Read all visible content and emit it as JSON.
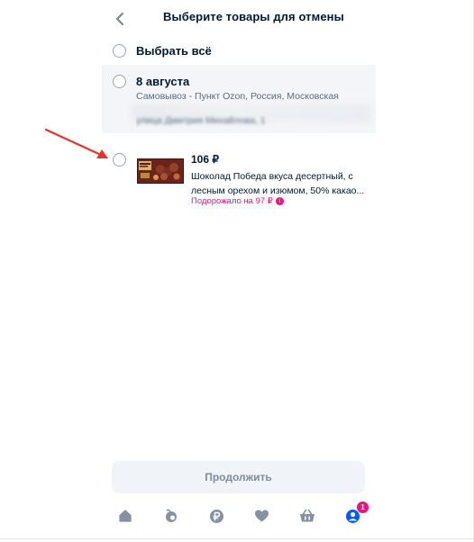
{
  "header": {
    "title": "Выберите товары для отмены"
  },
  "select_all": {
    "label": "Выбрать всё"
  },
  "group": {
    "date": "8 августа",
    "address": "Самовывоз - Пункт Ozon, Россия, Московская",
    "address_blurred": "улица Дмитрия Михайлова, 1"
  },
  "product": {
    "price": "106 ₽",
    "title": "Шоколад Победа вкуса десертный, с лесным орехом и изюмом, 50% какао...",
    "price_note": "Подорожало на 97 ₽",
    "note_icon": "i"
  },
  "footer": {
    "continue_label": "Продолжить"
  },
  "tabbar": {
    "items": [
      {
        "icon": "home-icon"
      },
      {
        "icon": "fresh-icon"
      },
      {
        "icon": "ruble-icon"
      },
      {
        "icon": "heart-icon"
      },
      {
        "icon": "cart-icon"
      },
      {
        "icon": "profile-icon"
      }
    ],
    "profile_badge": "1"
  },
  "colors": {
    "accent": "#005bff",
    "text": "#001a34",
    "secondary_text": "#5a6b7e",
    "magenta": "#f1117e",
    "annotation_arrow": "#e8332c"
  }
}
